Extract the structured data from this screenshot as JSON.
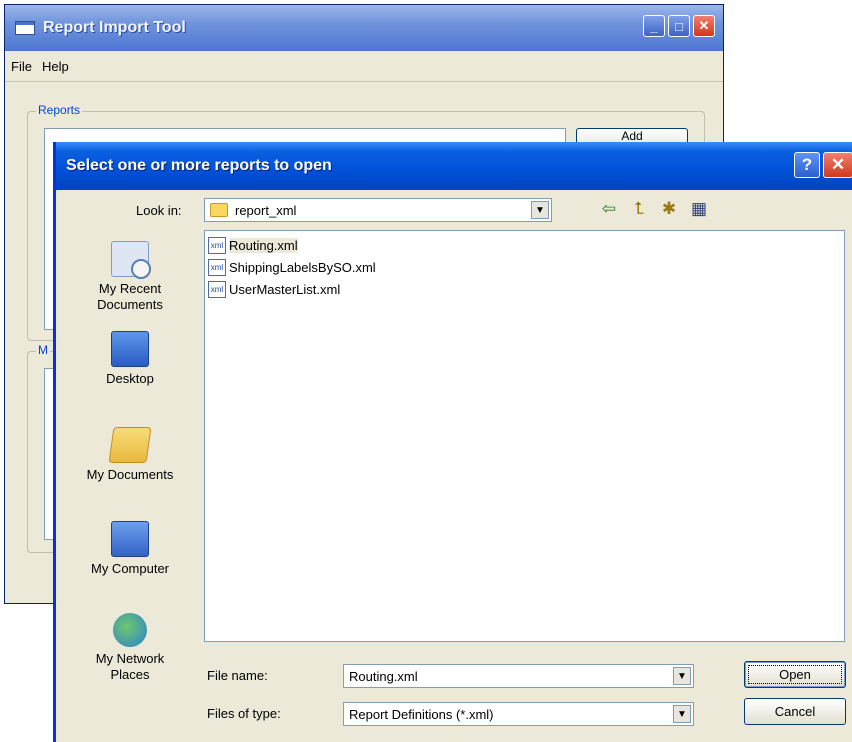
{
  "background_window": {
    "title": "Report Import Tool",
    "controls": [
      "_",
      "□",
      "✕"
    ],
    "menu": [
      "File",
      "Help"
    ],
    "reports_group_label": "Reports",
    "add_button_label": "Add",
    "second_group_label_partial": "M"
  },
  "dialog": {
    "title": "Select one or more reports to open",
    "help_label": "?",
    "close_label": "✕",
    "look_in_label": "Look in:",
    "look_in_value": "report_xml",
    "toolbar_icons": [
      "back-arrow-icon",
      "up-folder-icon",
      "new-folder-icon",
      "view-menu-icon"
    ],
    "places": [
      {
        "label": "My Recent Documents",
        "icon": "recent-documents-icon"
      },
      {
        "label": "Desktop",
        "icon": "desktop-icon"
      },
      {
        "label": "My Documents",
        "icon": "my-documents-icon"
      },
      {
        "label": "My Computer",
        "icon": "my-computer-icon"
      },
      {
        "label": "My Network Places",
        "icon": "network-places-icon"
      }
    ],
    "files": [
      {
        "name": "Routing.xml",
        "selected": true
      },
      {
        "name": "ShippingLabelsBySO.xml",
        "selected": false
      },
      {
        "name": "UserMasterList.xml",
        "selected": false
      }
    ],
    "file_name_label": "File name:",
    "file_name_value": "Routing.xml",
    "files_of_type_label": "Files of type:",
    "files_of_type_value": "Report Definitions (*.xml)",
    "open_label": "Open",
    "cancel_label": "Cancel"
  }
}
